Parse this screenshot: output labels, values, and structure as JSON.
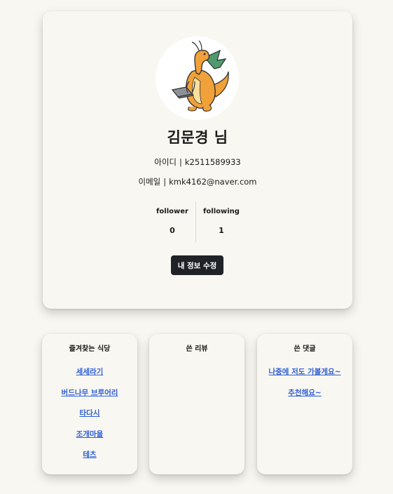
{
  "profile": {
    "name": "김문경 님",
    "id_label": "아이디",
    "id_value": "k2511589933",
    "email_label": "이메일",
    "email_value": "kmk4162@naver.com",
    "separator": "|",
    "followers": {
      "label": "follower",
      "count": "0"
    },
    "following": {
      "label": "following",
      "count": "1"
    },
    "edit_button_label": "내 정보 수정",
    "avatar_icon": "dragon-with-laptop-avatar"
  },
  "favorites": {
    "title": "즐겨찾는 식당",
    "items": [
      "세세라기",
      "버드나무 브루어리",
      "타다시",
      "조개마을",
      "테츠"
    ]
  },
  "reviews": {
    "title": "쓴 리뷰",
    "items": []
  },
  "comments": {
    "title": "쓴 댓글",
    "items": [
      "나중에 저도 가볼게요~",
      "추천해요~"
    ]
  },
  "colors": {
    "background": "#f8f7f1",
    "button": "#1f2226",
    "link": "#2f5fd6"
  }
}
